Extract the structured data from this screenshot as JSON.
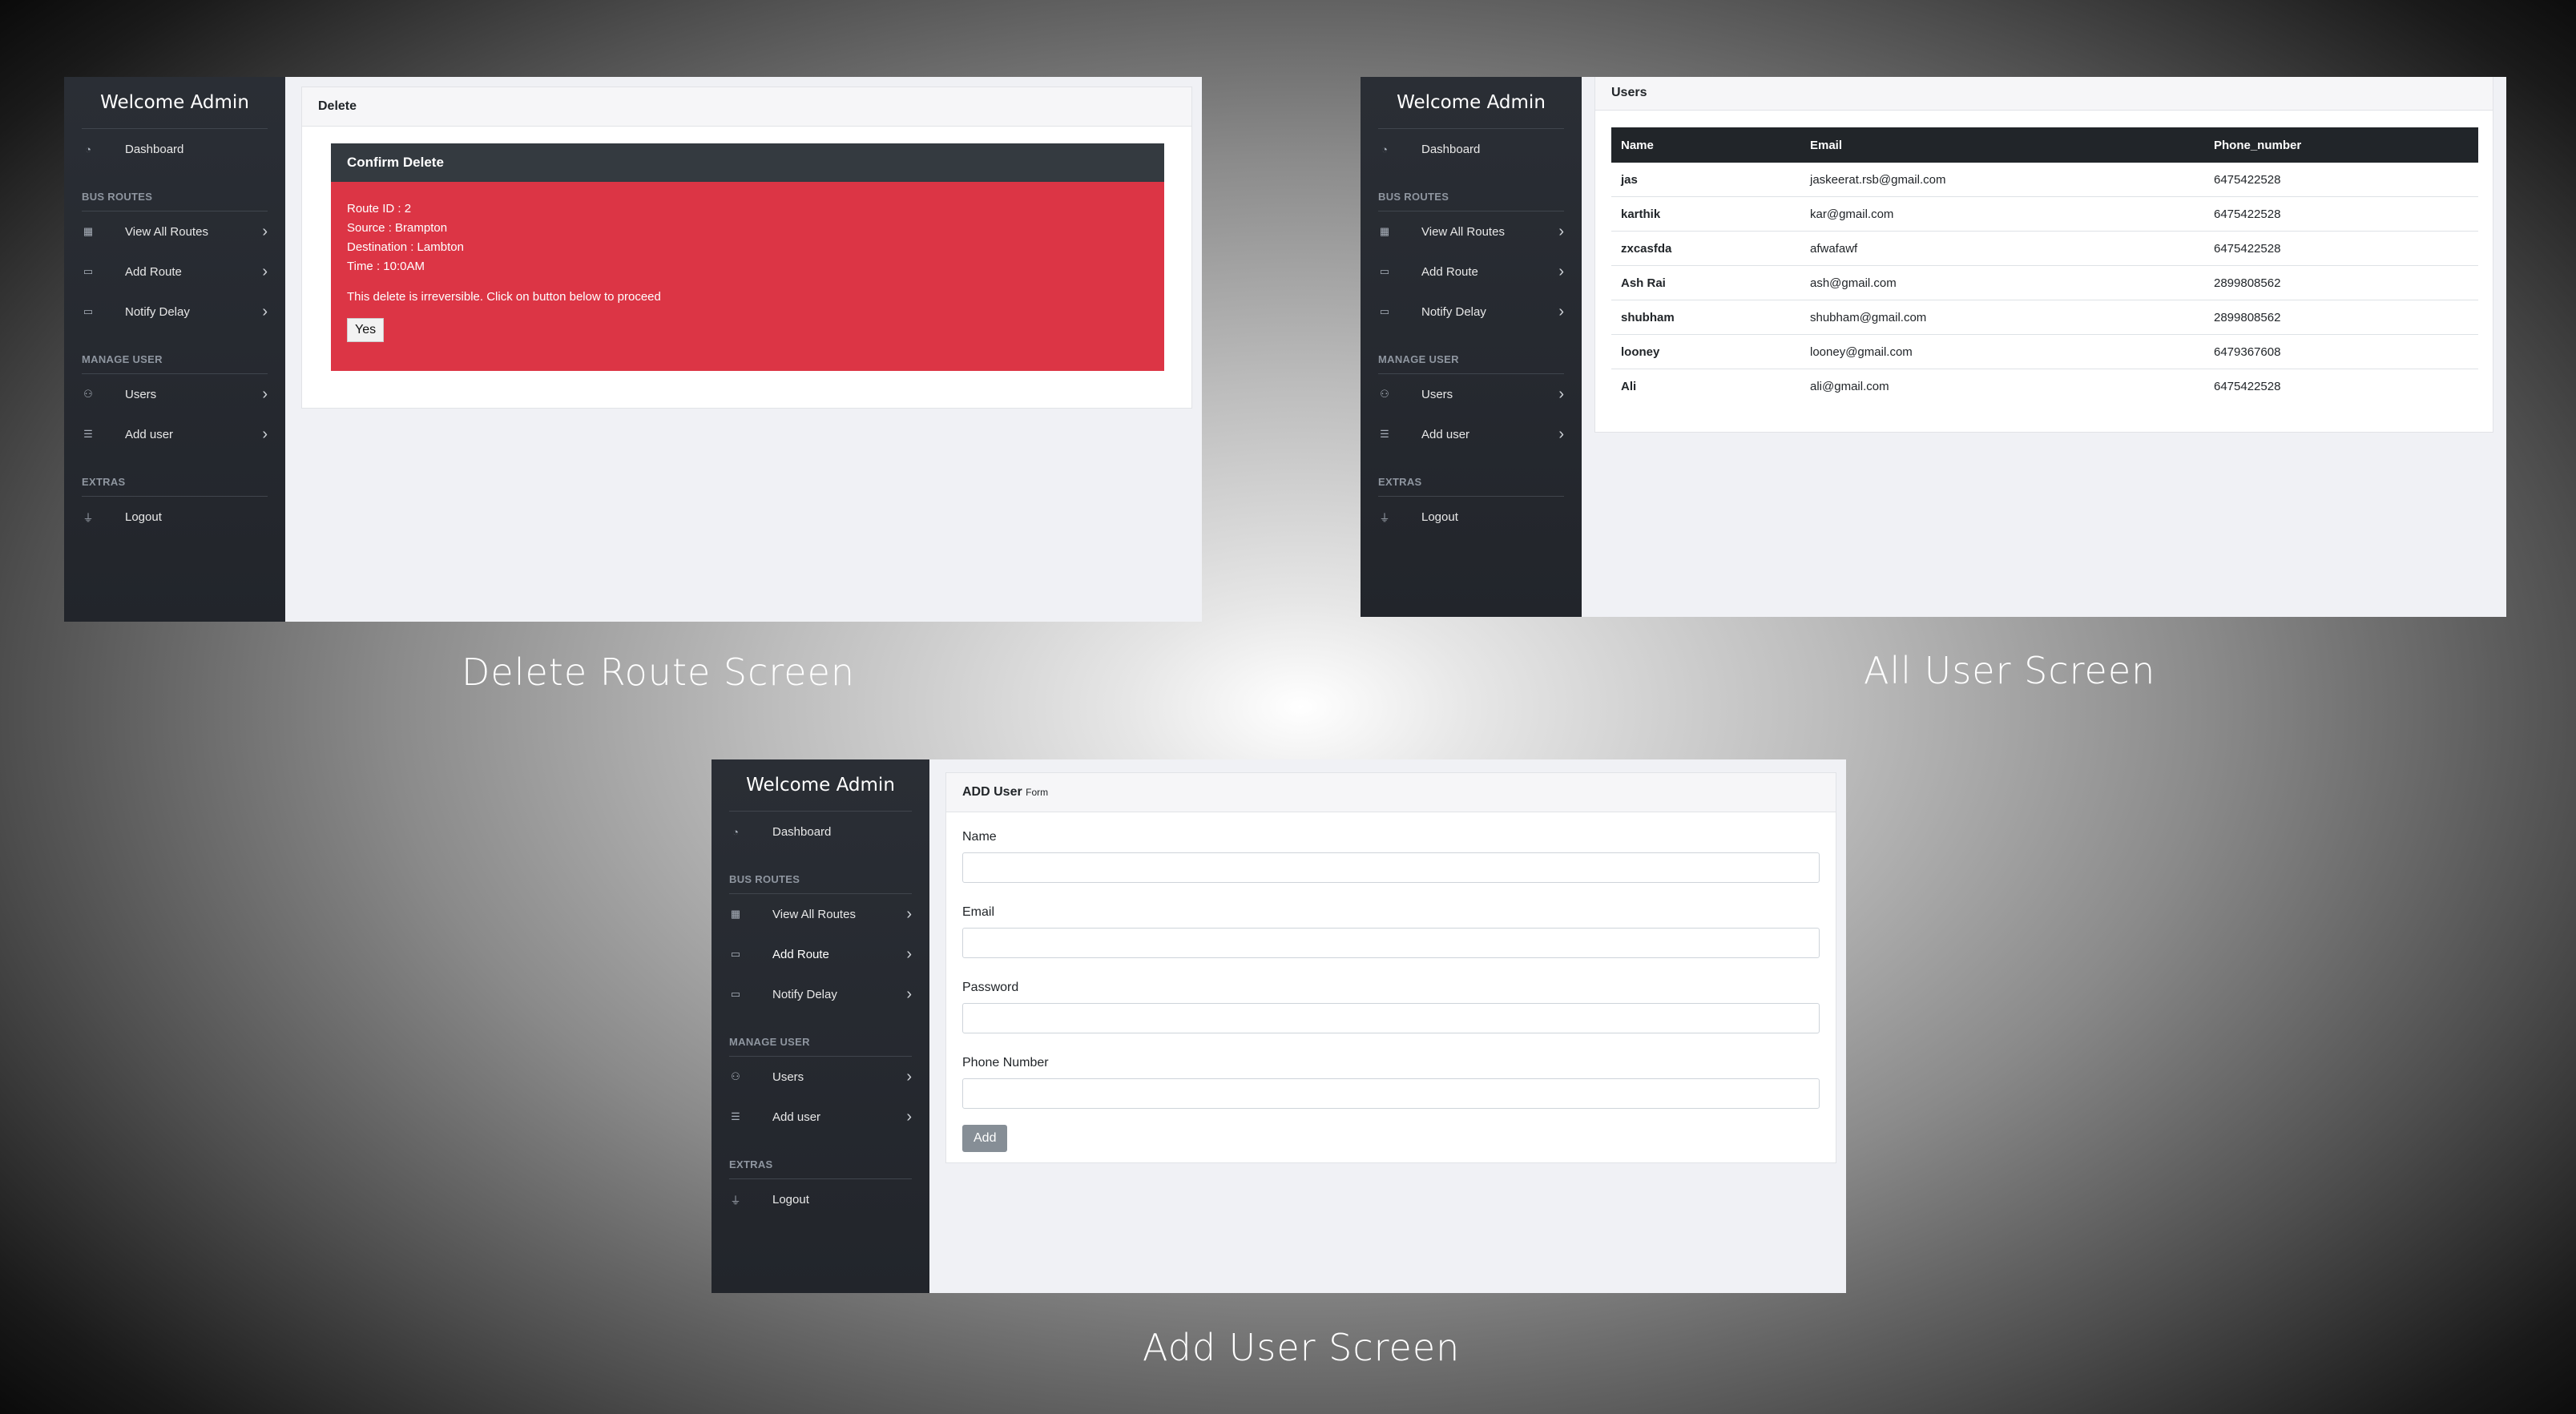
{
  "sidebar": {
    "title": "Welcome Admin",
    "dashboard": "Dashboard",
    "section_routes": "BUS ROUTES",
    "view_routes": "View All Routes",
    "add_route": "Add Route",
    "notify_delay": "Notify Delay",
    "section_users": "MANAGE USER",
    "users": "Users",
    "add_user": "Add user",
    "section_extras": "EXTRAS",
    "logout": "Logout",
    "icons": {
      "dashboard": "gauge-icon",
      "view_routes": "table-icon",
      "add_route": "laptop-icon",
      "notify_delay": "laptop-icon",
      "users": "users-icon",
      "add_user": "list-icon",
      "logout": "filter-icon",
      "chevron": "chevron-right-icon"
    }
  },
  "delete_screen": {
    "caption": "Delete Route Screen",
    "card_title": "Delete",
    "confirm_title": "Confirm Delete",
    "route_id": "Route ID : 2",
    "source": "Source : Brampton",
    "destination": "Destination : Lambton",
    "time": "Time : 10:0AM",
    "warning": "This delete is irreversible. Click on button below to proceed",
    "yes_label": "Yes"
  },
  "users_screen": {
    "caption": "All User Screen",
    "card_title": "Users",
    "columns": [
      "Name",
      "Email",
      "Phone_number"
    ],
    "rows": [
      [
        "jas",
        "jaskeerat.rsb@gmail.com",
        "6475422528"
      ],
      [
        "karthik",
        "kar@gmail.com",
        "6475422528"
      ],
      [
        "zxcasfda",
        "afwafawf",
        "6475422528"
      ],
      [
        "Ash Rai",
        "ash@gmail.com",
        "2899808562"
      ],
      [
        "shubham",
        "shubham@gmail.com",
        "2899808562"
      ],
      [
        "looney",
        "looney@gmail.com",
        "6479367608"
      ],
      [
        "Ali",
        "ali@gmail.com",
        "6475422528"
      ]
    ]
  },
  "add_user_screen": {
    "caption": "Add User Screen",
    "card_title": "ADD User",
    "card_subtitle": "Form",
    "name_label": "Name",
    "email_label": "Email",
    "password_label": "Password",
    "phone_label": "Phone Number",
    "add_label": "Add"
  },
  "colors": {
    "sidebar": "#2a2e35",
    "danger": "#dc3545",
    "dark": "#343a40",
    "table_head": "#212529",
    "button_secondary": "#868e96"
  }
}
